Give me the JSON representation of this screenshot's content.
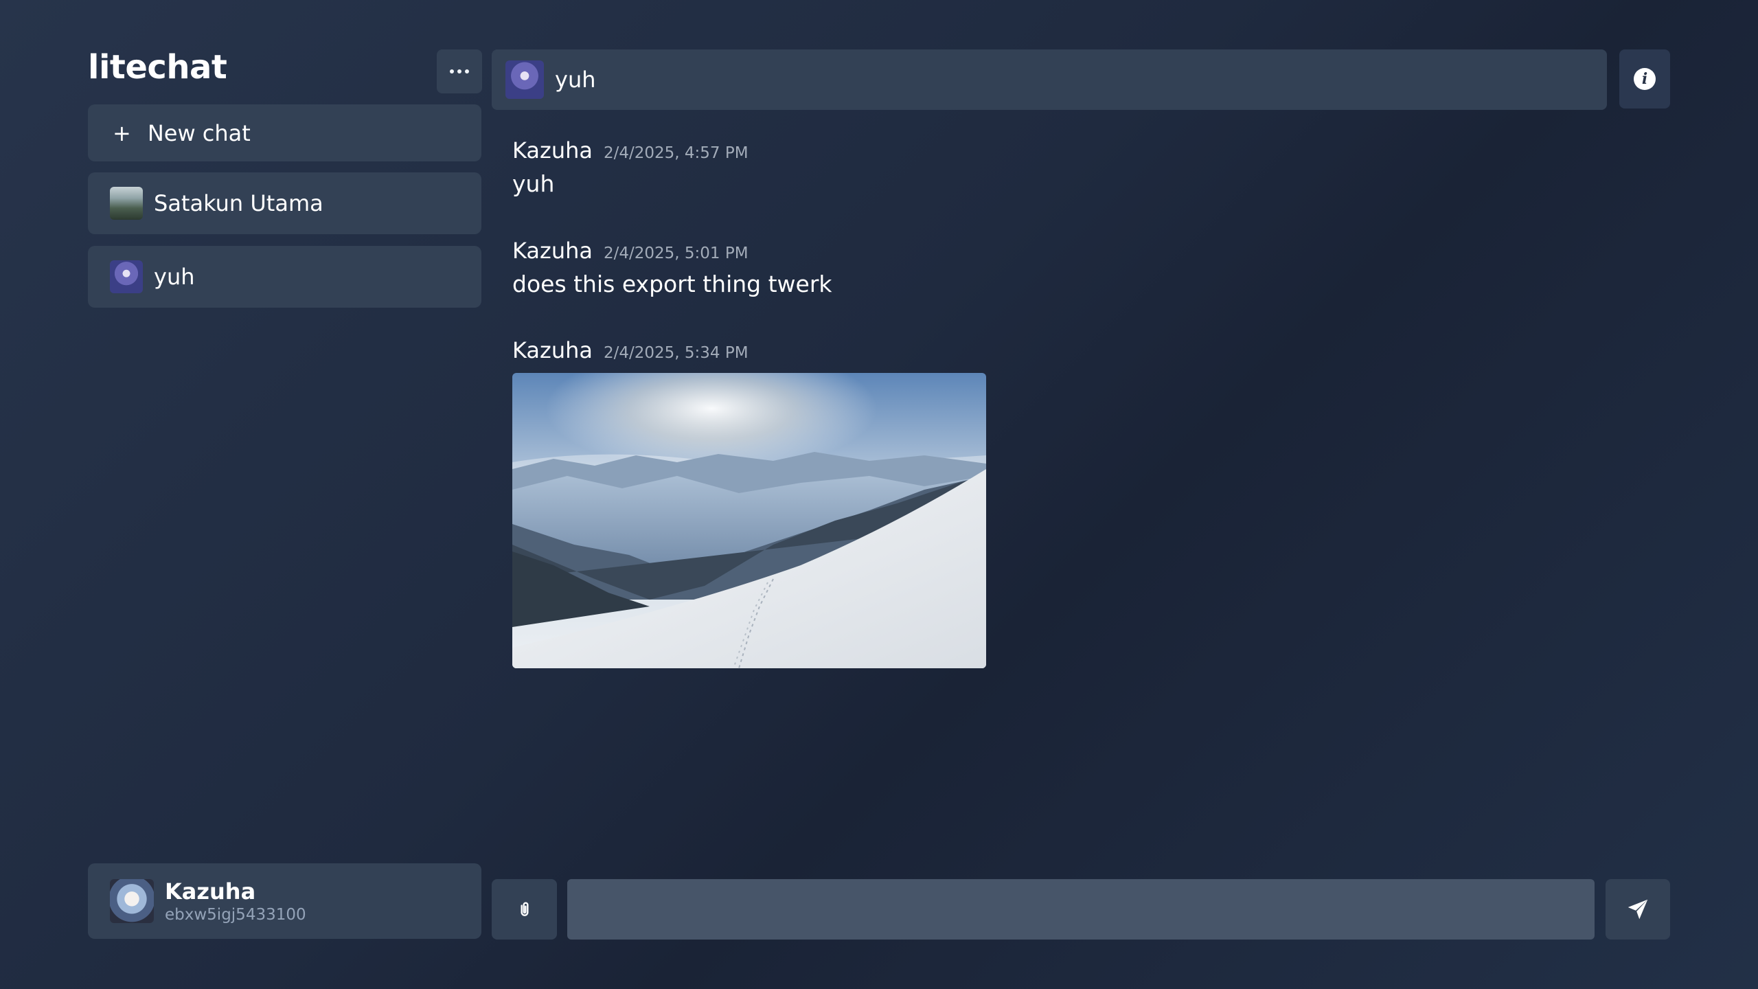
{
  "app": {
    "title": "litechat"
  },
  "sidebar": {
    "more_icon": "ellipsis-icon",
    "new_chat": {
      "icon": "plus-icon",
      "label": "New chat"
    },
    "chats": [
      {
        "name": "Satakun Utama",
        "avatar": "landscape-avatar"
      },
      {
        "name": "yuh",
        "avatar": "anime-avatar"
      }
    ],
    "profile": {
      "name": "Kazuha",
      "id": "ebxw5igj5433100"
    }
  },
  "chat": {
    "header": {
      "name": "yuh",
      "info_icon": "info-icon"
    },
    "messages": [
      {
        "author": "Kazuha",
        "time": "2/4/2025, 4:57 PM",
        "text": "yuh"
      },
      {
        "author": "Kazuha",
        "time": "2/4/2025, 5:01 PM",
        "text": "does this export thing twerk"
      },
      {
        "author": "Kazuha",
        "time": "2/4/2025, 5:34 PM",
        "image": "snowy-mountain-landscape"
      }
    ]
  },
  "composer": {
    "attach_icon": "paperclip-icon",
    "placeholder": "",
    "value": "",
    "send_icon": "send-icon"
  },
  "colors": {
    "panel": "#334155",
    "input": "#475569",
    "muted_text": "#94a3b8"
  }
}
